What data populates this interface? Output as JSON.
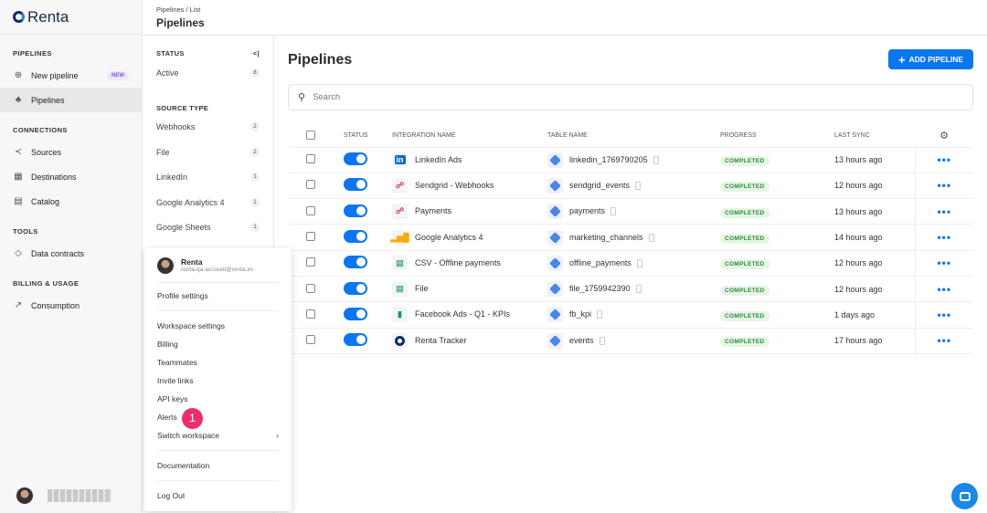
{
  "brand": "Renta",
  "sidebar": {
    "sections": [
      {
        "title": "PIPELINES",
        "items": [
          {
            "label": "New pipeline",
            "icon": "plus-circle-icon",
            "badge": "NEW"
          },
          {
            "label": "Pipelines",
            "icon": "pipelines-icon",
            "active": true
          }
        ]
      },
      {
        "title": "CONNECTIONS",
        "items": [
          {
            "label": "Sources",
            "icon": "share-icon"
          },
          {
            "label": "Destinations",
            "icon": "grid-icon"
          },
          {
            "label": "Catalog",
            "icon": "book-icon"
          }
        ]
      },
      {
        "title": "TOOLS",
        "items": [
          {
            "label": "Data contracts",
            "icon": "tag-icon"
          }
        ]
      },
      {
        "title": "BILLING & USAGE",
        "items": [
          {
            "label": "Consumption",
            "icon": "chart-icon"
          }
        ]
      }
    ]
  },
  "header": {
    "breadcrumb": "Pipelines / List",
    "title": "Pipelines"
  },
  "filters": {
    "status_title": "STATUS",
    "status": [
      {
        "label": "Active",
        "count": "8"
      }
    ],
    "source_title": "SOURCE TYPE",
    "sources": [
      {
        "label": "Webhooks",
        "count": "2"
      },
      {
        "label": "File",
        "count": "2"
      },
      {
        "label": "LinkedIn",
        "count": "1"
      },
      {
        "label": "Google Analytics 4",
        "count": "1"
      },
      {
        "label": "Google Sheets",
        "count": "1"
      }
    ]
  },
  "main": {
    "title": "Pipelines",
    "add_label": "ADD PIPELINE",
    "search_placeholder": "Search",
    "columns": [
      "STATUS",
      "INTEGRATION NAME",
      "TABLE NAME",
      "PROGRESS",
      "LAST SYNC"
    ],
    "rows": [
      {
        "name": "LinkedIn Ads",
        "icon": "linkedin",
        "table": "linkedin_1769790205",
        "progress": "COMPLETED",
        "sync": "13 hours ago"
      },
      {
        "name": "Sendgrid - Webhooks",
        "icon": "webhook",
        "table": "sendgrid_events",
        "progress": "COMPLETED",
        "sync": "12 hours ago"
      },
      {
        "name": "Payments",
        "icon": "webhook",
        "table": "payments",
        "progress": "COMPLETED",
        "sync": "13 hours ago"
      },
      {
        "name": "Google Analytics 4",
        "icon": "ga4",
        "table": "marketing_channels",
        "progress": "COMPLETED",
        "sync": "14 hours ago"
      },
      {
        "name": "CSV - Offline payments",
        "icon": "file",
        "table": "offline_payments",
        "progress": "COMPLETED",
        "sync": "12 hours ago"
      },
      {
        "name": "File",
        "icon": "file",
        "table": "file_1759942390",
        "progress": "COMPLETED",
        "sync": "12 hours ago"
      },
      {
        "name": "Facebook Ads - Q1 - KPIs",
        "icon": "sheets",
        "table": "fb_kpi",
        "progress": "COMPLETED",
        "sync": "1 days ago"
      },
      {
        "name": "Renta Tracker",
        "icon": "renta",
        "table": "events",
        "progress": "COMPLETED",
        "sync": "17 hours ago"
      }
    ]
  },
  "menu": {
    "name": "Renta",
    "email": "renta-qa-account@renta.im",
    "profile": "Profile settings",
    "items": [
      "Workspace settings",
      "Billing",
      "Teammates",
      "Invite links",
      "API keys",
      "Alerts"
    ],
    "switch": "Switch workspace",
    "docs": "Documentation",
    "logout": "Log Out",
    "step": "1"
  }
}
